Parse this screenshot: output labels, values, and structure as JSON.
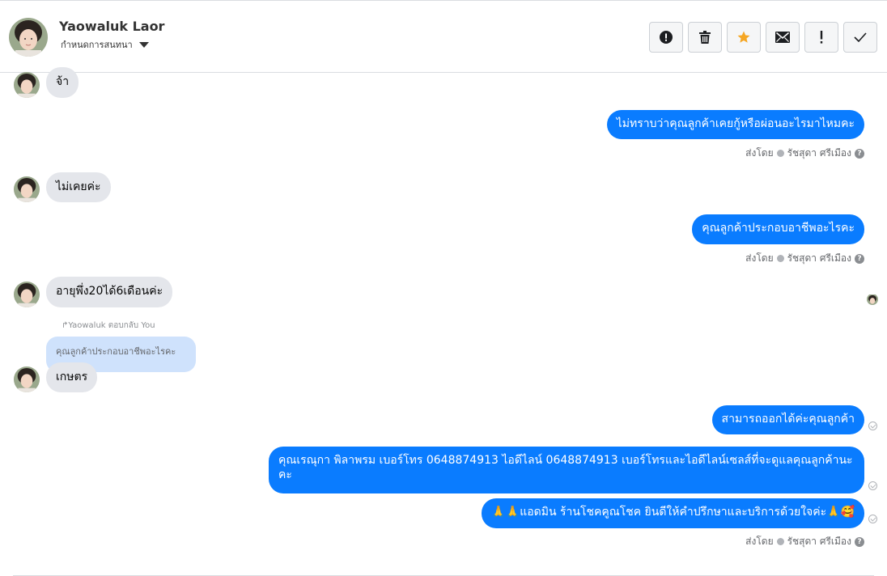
{
  "header": {
    "contact_name": "Yaowaluk Laor",
    "conversation_settings": "กำหนดการสนทนา"
  },
  "toolbar": {
    "buttons": [
      {
        "icon": "alert-circle-icon"
      },
      {
        "icon": "trash-icon"
      },
      {
        "icon": "star-icon",
        "color": "#f5a623"
      },
      {
        "icon": "envelope-icon"
      },
      {
        "icon": "exclamation-icon"
      },
      {
        "icon": "checkmark-icon"
      }
    ]
  },
  "messages": [
    {
      "from": "customer",
      "text": "จ้า"
    },
    {
      "from": "page",
      "text": "ไม่ทราบว่าคุณลูกค้าเคยกู้หรือผ่อนอะไรมาไหมคะ"
    },
    {
      "from": "customer",
      "text": "ไม่เคยค่ะ"
    },
    {
      "from": "page",
      "text": "คุณลูกค้าประกอบอาชีพอะไรคะ"
    },
    {
      "from": "customer",
      "text": "อายุพึ่ง20ได้6เดือนค่ะ"
    },
    {
      "from": "customer",
      "text": "เกษตร",
      "reply_hint": "Yaowaluk ตอบกลับ You",
      "quoted_text": "คุณลูกค้าประกอบอาชีพอะไรคะ"
    },
    {
      "from": "page",
      "text": "สามารถออกได้ค่ะคุณลูกค้า"
    },
    {
      "from": "page",
      "text": "คุณเรณุกา พิลาพรม       เบอร์โทร 0648874913  ไอดีไลน์ 0648874913   เบอร์โทรและไอดีไลน์เซลส์ที่จะดูแลคุณลูกค้านะคะ"
    },
    {
      "from": "page",
      "text": "🙏🙏แอดมิน ร้านโชคคูณโชค ยินดีให้คำปรึกษาและบริการด้วยใจค่ะ🙏🥰"
    }
  ],
  "sent_by": {
    "label": "ส่งโดย",
    "agent": "รัชสุดา ศรีเมือง",
    "help": "?"
  },
  "colors": {
    "outgoing_bubble": "#0a7cff",
    "incoming_bubble": "#e4e6eb",
    "quoted_bubble": "#cfe2fc"
  }
}
